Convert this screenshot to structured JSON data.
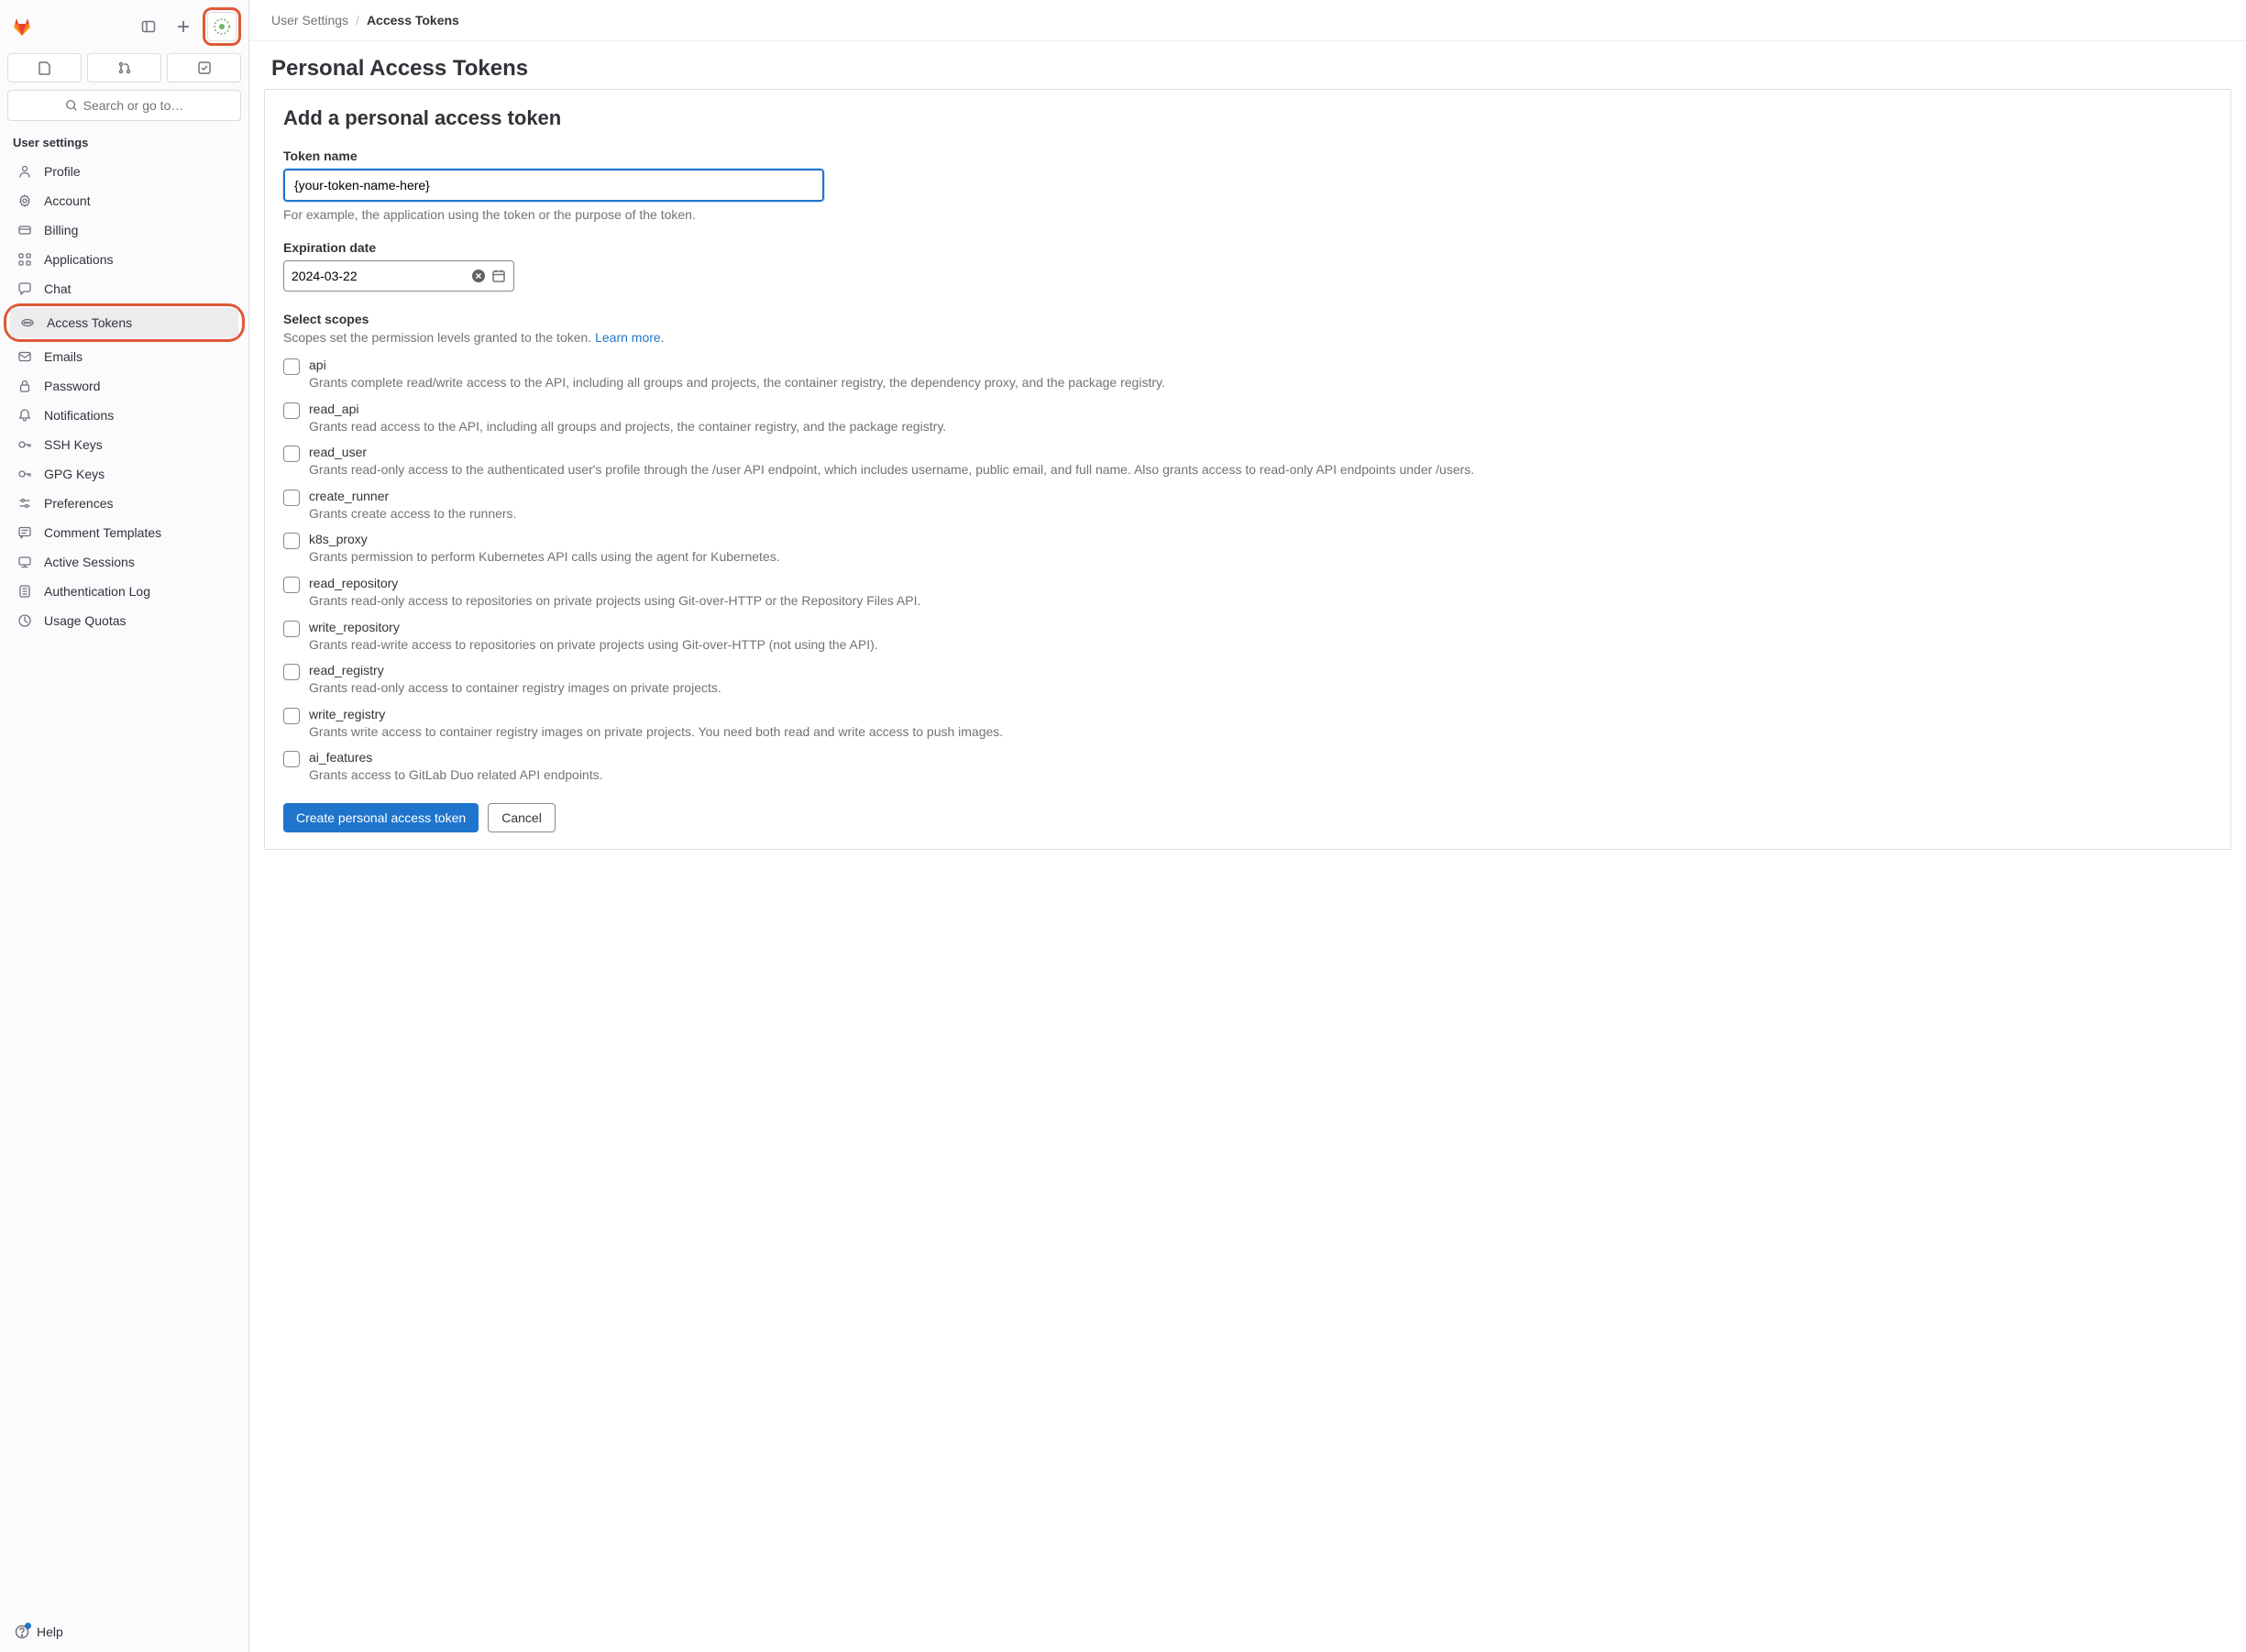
{
  "header": {
    "search_placeholder": "Search or go to…"
  },
  "breadcrumb": {
    "parent": "User Settings",
    "current": "Access Tokens"
  },
  "page": {
    "title": "Personal Access Tokens"
  },
  "sidebar": {
    "section_title": "User settings",
    "help_label": "Help",
    "items": [
      {
        "label": "Profile",
        "icon": "profile-icon"
      },
      {
        "label": "Account",
        "icon": "account-icon"
      },
      {
        "label": "Billing",
        "icon": "billing-icon"
      },
      {
        "label": "Applications",
        "icon": "applications-icon"
      },
      {
        "label": "Chat",
        "icon": "chat-icon"
      },
      {
        "label": "Access Tokens",
        "icon": "token-icon"
      },
      {
        "label": "Emails",
        "icon": "emails-icon"
      },
      {
        "label": "Password",
        "icon": "password-icon"
      },
      {
        "label": "Notifications",
        "icon": "notifications-icon"
      },
      {
        "label": "SSH Keys",
        "icon": "ssh-icon"
      },
      {
        "label": "GPG Keys",
        "icon": "gpg-icon"
      },
      {
        "label": "Preferences",
        "icon": "preferences-icon"
      },
      {
        "label": "Comment Templates",
        "icon": "comment-icon"
      },
      {
        "label": "Active Sessions",
        "icon": "sessions-icon"
      },
      {
        "label": "Authentication Log",
        "icon": "authlog-icon"
      },
      {
        "label": "Usage Quotas",
        "icon": "quota-icon"
      }
    ]
  },
  "form": {
    "heading": "Add a personal access token",
    "token_name_label": "Token name",
    "token_name_value": "{your-token-name-here}",
    "token_name_hint": "For example, the application using the token or the purpose of the token.",
    "expiration_label": "Expiration date",
    "expiration_value": "2024-03-22",
    "scopes_label": "Select scopes",
    "scopes_hint": "Scopes set the permission levels granted to the token. ",
    "scopes_learn_more": "Learn more.",
    "submit_label": "Create personal access token",
    "cancel_label": "Cancel",
    "scopes": [
      {
        "name": "api",
        "desc": "Grants complete read/write access to the API, including all groups and projects, the container registry, the dependency proxy, and the package registry."
      },
      {
        "name": "read_api",
        "desc": "Grants read access to the API, including all groups and projects, the container registry, and the package registry."
      },
      {
        "name": "read_user",
        "desc": "Grants read-only access to the authenticated user's profile through the /user API endpoint, which includes username, public email, and full name. Also grants access to read-only API endpoints under /users."
      },
      {
        "name": "create_runner",
        "desc": "Grants create access to the runners."
      },
      {
        "name": "k8s_proxy",
        "desc": "Grants permission to perform Kubernetes API calls using the agent for Kubernetes."
      },
      {
        "name": "read_repository",
        "desc": "Grants read-only access to repositories on private projects using Git-over-HTTP or the Repository Files API."
      },
      {
        "name": "write_repository",
        "desc": "Grants read-write access to repositories on private projects using Git-over-HTTP (not using the API)."
      },
      {
        "name": "read_registry",
        "desc": "Grants read-only access to container registry images on private projects."
      },
      {
        "name": "write_registry",
        "desc": "Grants write access to container registry images on private projects. You need both read and write access to push images."
      },
      {
        "name": "ai_features",
        "desc": "Grants access to GitLab Duo related API endpoints."
      }
    ]
  }
}
